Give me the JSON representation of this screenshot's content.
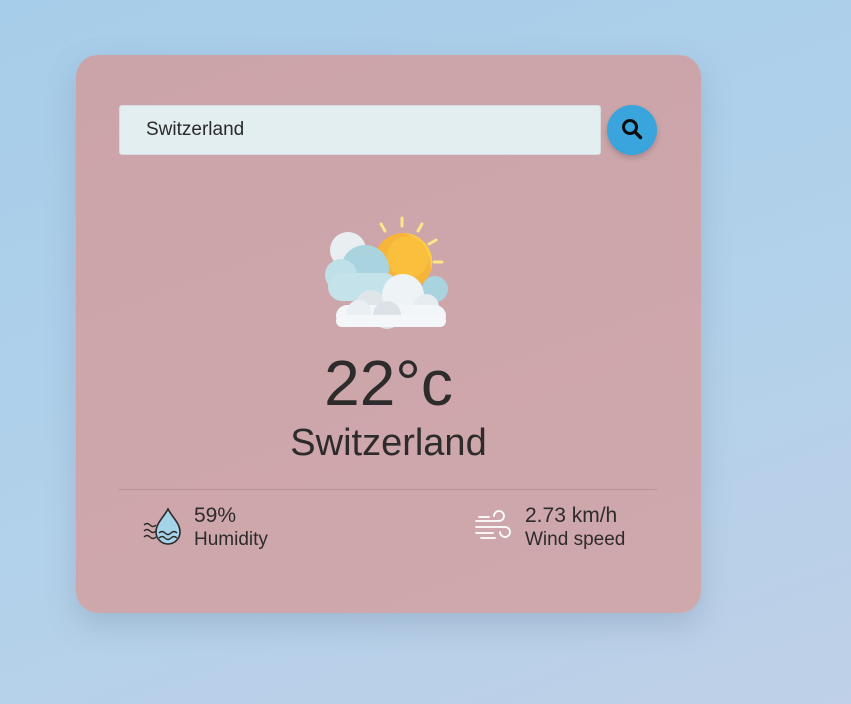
{
  "search": {
    "value": "Switzerland"
  },
  "weather": {
    "icon": "partly-cloudy-icon",
    "temperature": "22°c",
    "city": "Switzerland"
  },
  "details": {
    "humidity": {
      "icon": "humidity-icon",
      "value": "59%",
      "label": "Humidity"
    },
    "wind": {
      "icon": "wind-icon",
      "value": "2.73 km/h",
      "label": "Wind speed"
    }
  },
  "colors": {
    "card_background": "#cfa8ac",
    "search_button": "#3aa4dd",
    "input_background": "#e3eef1",
    "text": "#2e2b2c"
  }
}
